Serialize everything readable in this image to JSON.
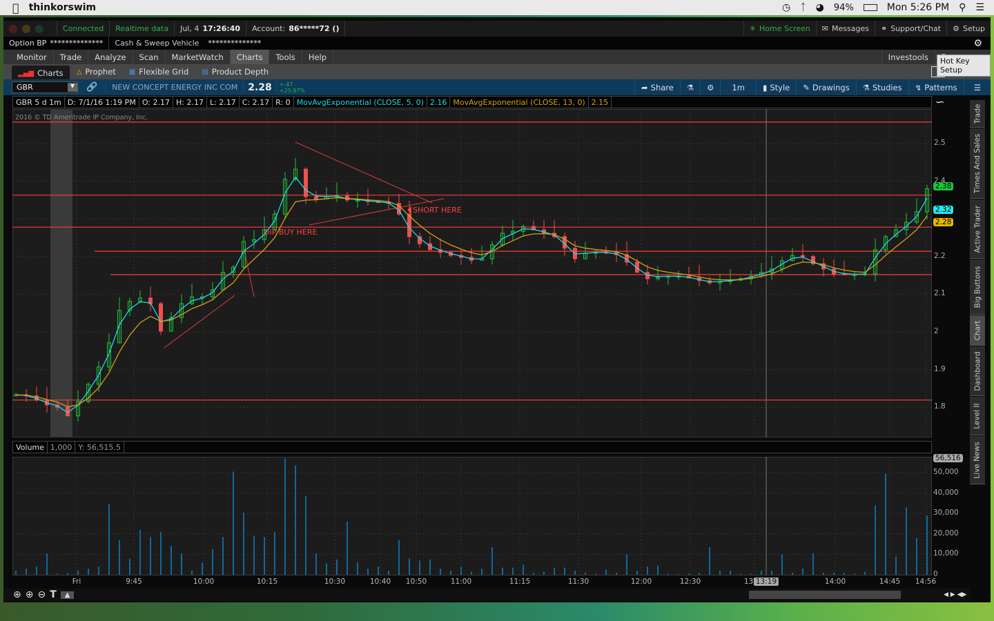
{
  "os": {
    "app": "thinkorswim",
    "battery": "94%",
    "clock": "Mon 5:26 PM"
  },
  "status": {
    "connected": "Connected",
    "realtime": "Realtime data",
    "date": "Jul, 4",
    "time": "17:26:40",
    "account_label": "Account:",
    "account": "86*****72 ()",
    "home": "Home Screen",
    "messages": "Messages",
    "support": "Support/Chat",
    "setup": "Setup"
  },
  "account_bar": {
    "option_bp": "Option BP",
    "option_bp_value": "**************",
    "cash": "Cash & Sweep Vehicle",
    "cash_value": "**************"
  },
  "tabs": [
    "Monitor",
    "Trade",
    "Analyze",
    "Scan",
    "MarketWatch",
    "Charts",
    "Tools",
    "Help"
  ],
  "active_tab": "Charts",
  "investools": "Investools",
  "tooltip": "Hot Key Setup",
  "subtabs": [
    "Charts",
    "Prophet",
    "Flexible Grid",
    "Product Depth"
  ],
  "symbol": {
    "ticker": "GBR",
    "name": "NEW CONCEPT ENERGY INC COM",
    "last": "2.28",
    "change": "+.47",
    "change_pct": "+25.97%"
  },
  "toolbar": {
    "share": "Share",
    "timeframe": "1m",
    "style": "Style",
    "drawings": "Drawings",
    "studies": "Studies",
    "patterns": "Patterns"
  },
  "info": {
    "period": "GBR 5 d 1m",
    "date": "D: 7/1/16 1:19 PM",
    "open": "O: 2.17",
    "high": "H: 2.17",
    "low": "L: 2.17",
    "close": "C: 2.17",
    "range": "R: 0",
    "ema5": "MovAvgExponential (CLOSE, 5, 0)",
    "ema5_val": "2.16",
    "ema13": "MovAvgExponential (CLOSE, 13, 0)",
    "ema13_val": "2.15"
  },
  "copyright": "2016 © TD Ameritrade IP Company, Inc.",
  "annotations": {
    "short": "SHORT HERE",
    "dip": "DIP BUY HERE"
  },
  "volume_header": {
    "label": "Volume",
    "unit": "1,000",
    "y": "Y: 56,515.5"
  },
  "right_tabs": [
    "Trade",
    "Times And Sales",
    "Active Trader",
    "Big Buttons",
    "Chart",
    "Dashboard",
    "Level II",
    "Live News"
  ],
  "colors": {
    "up": "#1fc43a",
    "down": "#f05050",
    "ema5": "#22d8e8",
    "ema13": "#d4a017",
    "level": "#ff3b3b",
    "volume": "#0f6a9a"
  },
  "chart_data": [
    {
      "type": "candlestick",
      "title": "GBR 5 d 1m",
      "price_axis": [
        "2.5",
        "2.4",
        "2.3",
        "2.2",
        "2.1",
        "2",
        "1.9",
        "1.8"
      ],
      "ylim": [
        1.72,
        2.62
      ],
      "time_axis": [
        "Fri",
        "9:45",
        "10:00",
        "10:15",
        "10:30",
        "10:40",
        "10:50",
        "11:00",
        "11:15",
        "11:30",
        "12:00",
        "12:30",
        "13:00",
        "13:19",
        "14:00",
        "14:45",
        "14:56"
      ],
      "closes": [
        1.833,
        1.83,
        1.819,
        1.806,
        1.8,
        1.777,
        1.815,
        1.861,
        1.907,
        1.971,
        2.057,
        2.081,
        2.09,
        2.075,
        2.002,
        2.038,
        2.075,
        2.093,
        2.093,
        2.112,
        2.158,
        2.172,
        2.24,
        2.245,
        2.271,
        2.313,
        2.405,
        2.432,
        2.359,
        2.353,
        2.359,
        2.361,
        2.35,
        2.35,
        2.346,
        2.344,
        2.341,
        2.313,
        2.253,
        2.234,
        2.218,
        2.211,
        2.203,
        2.198,
        2.19,
        2.194,
        2.231,
        2.262,
        2.267,
        2.28,
        2.271,
        2.262,
        2.253,
        2.222,
        2.194,
        2.209,
        2.212,
        2.211,
        2.205,
        2.185,
        2.158,
        2.141,
        2.145,
        2.148,
        2.148,
        2.143,
        2.136,
        2.13,
        2.134,
        2.137,
        2.141,
        2.148,
        2.158,
        2.167,
        2.189,
        2.203,
        2.2,
        2.181,
        2.167,
        2.154,
        2.152,
        2.152,
        2.154,
        2.218,
        2.253,
        2.271,
        2.291,
        2.319,
        2.38
      ],
      "price_levels": [
        2.557,
        2.363,
        2.278,
        2.214,
        2.152,
        1.819
      ],
      "last_badges": {
        "last": "2.38",
        "ema5": "2.32",
        "ema13": "2.28"
      }
    },
    {
      "type": "bar",
      "title": "Volume",
      "volume_axis": [
        "50,000",
        "40,000",
        "30,000",
        "20,000",
        "10,000",
        "0"
      ],
      "ylim": [
        0,
        57000
      ],
      "max_badge": "56,516",
      "values": [
        2000,
        3000,
        4000,
        10500,
        500,
        1000,
        2000,
        3000,
        4000,
        34500,
        17000,
        8000,
        22000,
        18500,
        21000,
        14000,
        10500,
        2000,
        6000,
        12500,
        18500,
        50500,
        30500,
        19000,
        18500,
        21000,
        57000,
        53500,
        38500,
        10500,
        5500,
        7500,
        26000,
        6000,
        3000,
        4000,
        2000,
        17000,
        8000,
        7000,
        7500,
        3000,
        2000,
        4000,
        1500,
        3000,
        13500,
        3500,
        3500,
        5000,
        1000,
        1500,
        3500,
        3500,
        2000,
        1000,
        500,
        2500,
        1000,
        10000,
        2000,
        4000,
        4500,
        500,
        300,
        500,
        1000,
        13500,
        2000,
        2000,
        500,
        500,
        2000,
        2000,
        10000,
        1000,
        3000,
        10500,
        1000,
        1000,
        1000,
        500,
        1500,
        34000,
        49500,
        9000,
        33000,
        18000,
        29000,
        13500
      ]
    }
  ]
}
